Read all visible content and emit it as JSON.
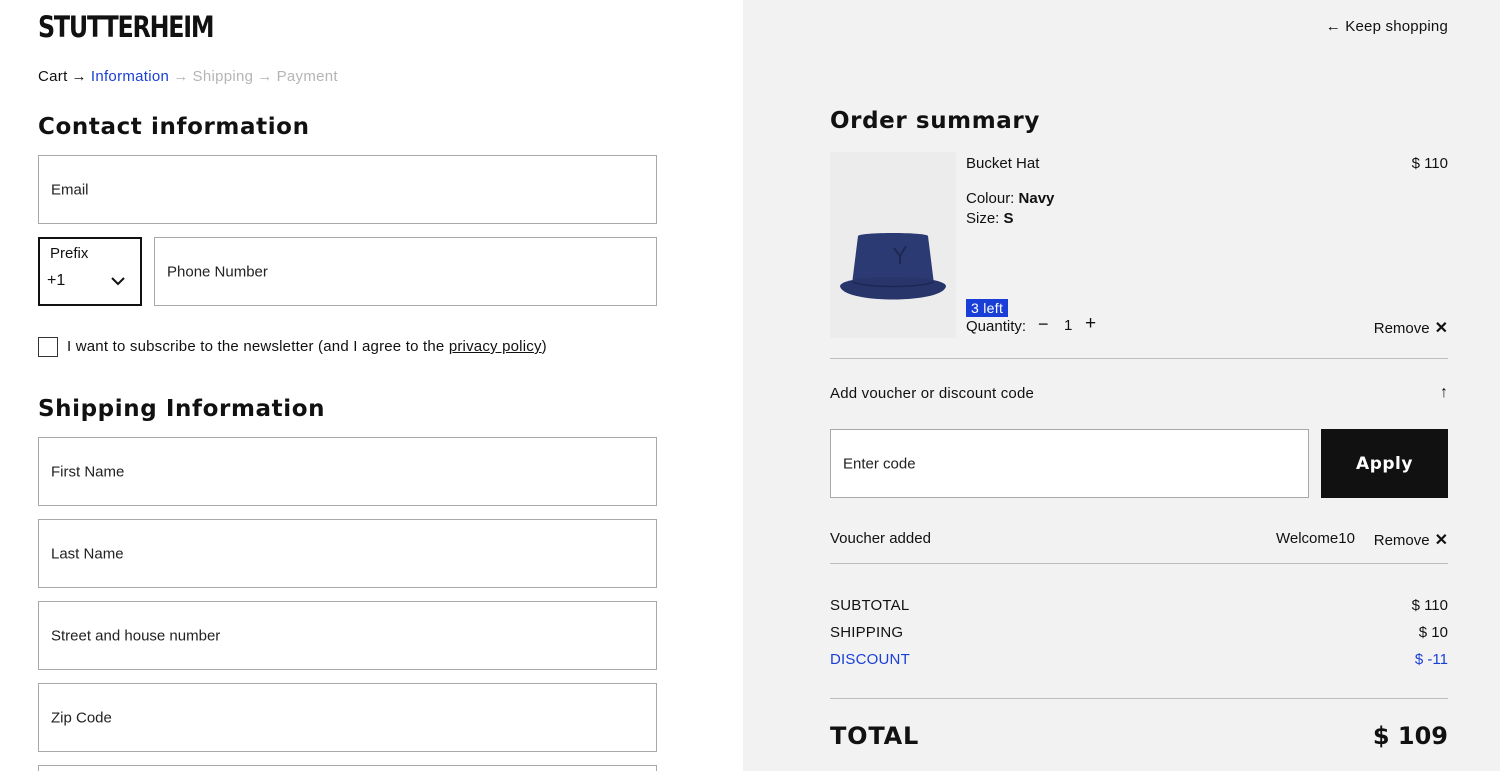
{
  "brand": "STUTTERHEIM",
  "breadcrumb": {
    "cart": "Cart",
    "information": "Information",
    "shipping": "Shipping",
    "payment": "Payment",
    "arrow": "→"
  },
  "contact": {
    "title": "Contact information",
    "email_placeholder": "Email",
    "prefix_label": "Prefix",
    "prefix_value": "+1",
    "phone_placeholder": "Phone Number",
    "newsletter_text": "I want to subscribe to the newsletter (and I agree to the ",
    "privacy_link": "privacy policy",
    "newsletter_end": ")"
  },
  "shipping": {
    "title": "Shipping Information",
    "first_name": "First Name",
    "last_name": "Last Name",
    "street": "Street and house number",
    "zip": "Zip Code"
  },
  "header": {
    "keep_shopping": "← Keep shopping"
  },
  "summary": {
    "title": "Order summary",
    "product": {
      "name": "Bucket Hat",
      "price": "$ 110",
      "colour_label": "Colour: ",
      "colour_value": "Navy",
      "size_label": "Size: ",
      "size_value": "S",
      "stock_badge": "3 left",
      "quantity_label": "Quantity:",
      "quantity": "1",
      "minus": "−",
      "plus": "+",
      "remove": "Remove",
      "remove_x": "✕"
    },
    "voucher": {
      "toggle_label": "Add voucher or discount code",
      "toggle_arrow": "↑",
      "code_placeholder": "Enter code",
      "apply": "Apply",
      "added_label": "Voucher added",
      "added_code": "Welcome10",
      "remove": "Remove",
      "remove_x": "✕"
    },
    "totals": {
      "subtotal_label": "SUBTOTAL",
      "subtotal": "$ 110",
      "shipping_label": "SHIPPING",
      "shipping": "$ 10",
      "discount_label": "DISCOUNT",
      "discount": "$ -11",
      "total_label": "TOTAL",
      "total": "$ 109"
    }
  },
  "colors": {
    "accent_blue": "#1a3fd6",
    "summary_bg": "#f2f2f2",
    "apply_bg": "#111111",
    "hat_navy": "#2b3a73"
  },
  "icons": [
    "chevron-down-icon",
    "arrow-left-icon",
    "arrow-up-icon",
    "close-icon",
    "minus-icon",
    "plus-icon",
    "checkbox-icon"
  ]
}
